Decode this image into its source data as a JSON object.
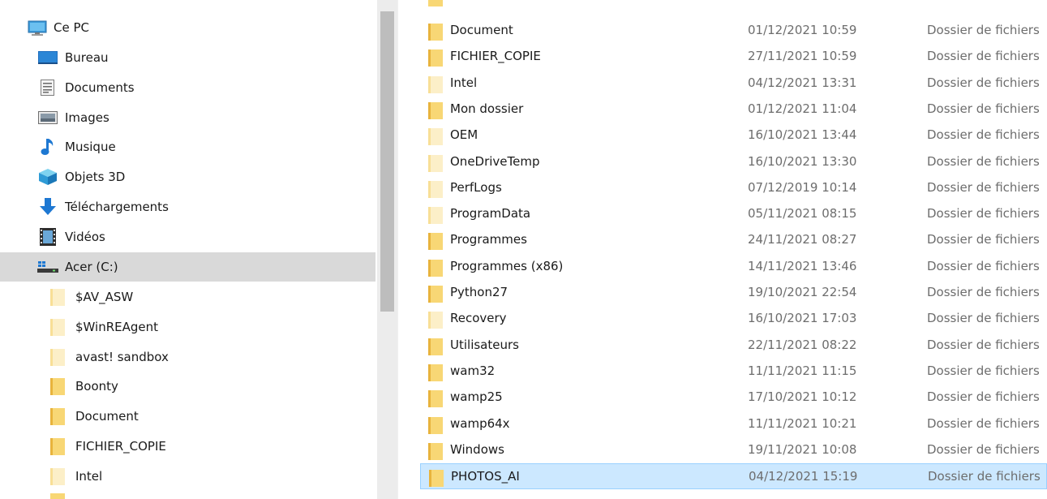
{
  "colors": {
    "selection": "#cce8ff",
    "folder_yellow": "#f8d775",
    "folder_pale": "#fbecc0"
  },
  "nav": {
    "items": [
      {
        "label": "Ce PC",
        "icon": "pc-icon"
      },
      {
        "label": "Bureau",
        "icon": "desktop-icon"
      },
      {
        "label": "Documents",
        "icon": "documents-icon"
      },
      {
        "label": "Images",
        "icon": "images-icon"
      },
      {
        "label": "Musique",
        "icon": "music-icon"
      },
      {
        "label": "Objets 3D",
        "icon": "objects3d-icon"
      },
      {
        "label": "Téléchargements",
        "icon": "downloads-icon"
      },
      {
        "label": "Vidéos",
        "icon": "videos-icon"
      },
      {
        "label": "Acer (C:)",
        "icon": "drive-icon",
        "selected": true
      },
      {
        "label": "$AV_ASW",
        "icon": "folder-icon",
        "pale": true
      },
      {
        "label": "$WinREAgent",
        "icon": "folder-icon",
        "pale": true
      },
      {
        "label": "avast! sandbox",
        "icon": "folder-icon",
        "pale": true
      },
      {
        "label": "Boonty",
        "icon": "folder-icon"
      },
      {
        "label": "Document",
        "icon": "folder-icon"
      },
      {
        "label": "FICHIER_COPIE",
        "icon": "folder-icon"
      },
      {
        "label": "Intel",
        "icon": "folder-icon",
        "pale": true
      }
    ]
  },
  "files": [
    {
      "name": "Document",
      "date": "01/12/2021 10:59",
      "type": "Dossier de fichiers"
    },
    {
      "name": "FICHIER_COPIE",
      "date": "27/11/2021 10:59",
      "type": "Dossier de fichiers"
    },
    {
      "name": "Intel",
      "date": "04/12/2021 13:31",
      "type": "Dossier de fichiers",
      "pale": true
    },
    {
      "name": "Mon dossier",
      "date": "01/12/2021 11:04",
      "type": "Dossier de fichiers"
    },
    {
      "name": "OEM",
      "date": "16/10/2021 13:44",
      "type": "Dossier de fichiers",
      "pale": true
    },
    {
      "name": "OneDriveTemp",
      "date": "16/10/2021 13:30",
      "type": "Dossier de fichiers",
      "pale": true
    },
    {
      "name": "PerfLogs",
      "date": "07/12/2019 10:14",
      "type": "Dossier de fichiers",
      "pale": true
    },
    {
      "name": "ProgramData",
      "date": "05/11/2021 08:15",
      "type": "Dossier de fichiers",
      "pale": true
    },
    {
      "name": "Programmes",
      "date": "24/11/2021 08:27",
      "type": "Dossier de fichiers"
    },
    {
      "name": "Programmes (x86)",
      "date": "14/11/2021 13:46",
      "type": "Dossier de fichiers"
    },
    {
      "name": "Python27",
      "date": "19/10/2021 22:54",
      "type": "Dossier de fichiers"
    },
    {
      "name": "Recovery",
      "date": "16/10/2021 17:03",
      "type": "Dossier de fichiers",
      "pale": true
    },
    {
      "name": "Utilisateurs",
      "date": "22/11/2021 08:22",
      "type": "Dossier de fichiers"
    },
    {
      "name": "wam32",
      "date": "11/11/2021 11:15",
      "type": "Dossier de fichiers"
    },
    {
      "name": "wamp25",
      "date": "17/10/2021 10:12",
      "type": "Dossier de fichiers"
    },
    {
      "name": "wamp64x",
      "date": "11/11/2021 10:21",
      "type": "Dossier de fichiers"
    },
    {
      "name": "Windows",
      "date": "19/11/2021 10:08",
      "type": "Dossier de fichiers"
    },
    {
      "name": "PHOTOS_AI",
      "date": "04/12/2021 15:19",
      "type": "Dossier de fichiers",
      "selected": true
    }
  ]
}
